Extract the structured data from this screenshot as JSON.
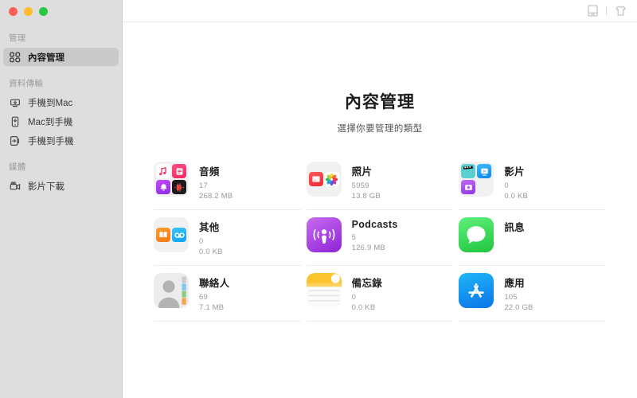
{
  "window": {
    "traffic_lights": [
      "close-red",
      "minimize-yellow",
      "maximize-green"
    ],
    "colors": {
      "close": "#ff5f57",
      "minimize": "#febc2e",
      "maximize": "#28c840"
    }
  },
  "topbar": {
    "icons": [
      {
        "name": "device-icon",
        "label": ""
      },
      {
        "name": "toolkit-shirt-icon",
        "label": ""
      }
    ]
  },
  "sidebar": {
    "sections": [
      {
        "label": "管理",
        "items": [
          {
            "label": "內容管理",
            "icon": "grid-squares-icon",
            "active": true
          }
        ]
      },
      {
        "label": "資料傳輸",
        "items": [
          {
            "label": "手機到Mac",
            "icon": "phone-to-mac-icon",
            "active": false
          },
          {
            "label": "Mac到手機",
            "icon": "mac-to-phone-icon",
            "active": false
          },
          {
            "label": "手機到手機",
            "icon": "phone-to-phone-icon",
            "active": false
          }
        ]
      },
      {
        "label": "媒體",
        "items": [
          {
            "label": "影片下載",
            "icon": "video-download-icon",
            "active": false
          }
        ]
      }
    ]
  },
  "main": {
    "title": "內容管理",
    "subtitle": "選擇你要管理的類型",
    "cards": [
      {
        "name": "音頻",
        "count": "17",
        "size": "268.2 MB",
        "icon": "audio-group-icon"
      },
      {
        "name": "照片",
        "count": "5959",
        "size": "13.8 GB",
        "icon": "photos-group-icon"
      },
      {
        "name": "影片",
        "count": "0",
        "size": "0.0 KB",
        "icon": "videos-group-icon"
      },
      {
        "name": "其他",
        "count": "0",
        "size": "0.0 KB",
        "icon": "other-group-icon"
      },
      {
        "name": "Podcasts",
        "count": "5",
        "size": "126.9 MB",
        "icon": "podcasts-icon"
      },
      {
        "name": "訊息",
        "count": "",
        "size": "",
        "icon": "messages-icon"
      },
      {
        "name": "聯絡人",
        "count": "69",
        "size": "7.1 MB",
        "icon": "contacts-icon"
      },
      {
        "name": "備忘錄",
        "count": "0",
        "size": "0.0 KB",
        "icon": "notes-icon"
      },
      {
        "name": "應用",
        "count": "105",
        "size": "22.0 GB",
        "icon": "appstore-icon"
      }
    ]
  }
}
